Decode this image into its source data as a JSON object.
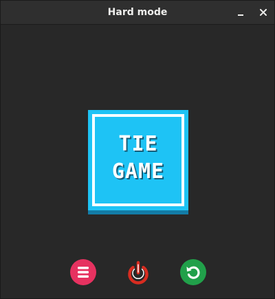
{
  "window": {
    "title": "Hard mode",
    "minimize_icon": "minimize-icon",
    "close_icon": "close-icon"
  },
  "board": {
    "result_line1": "TIE",
    "result_line2": "GAME",
    "colors": {
      "face": "#1ec3f5",
      "shadow": "#137ca6",
      "frame": "#ffffff"
    }
  },
  "actions": [
    {
      "name": "menu",
      "icon": "hamburger-menu-icon",
      "color": "#e63260"
    },
    {
      "name": "quit",
      "icon": "power-icon",
      "color": "#d82c20"
    },
    {
      "name": "restart",
      "icon": "restart-icon",
      "color": "#21a04a"
    }
  ]
}
